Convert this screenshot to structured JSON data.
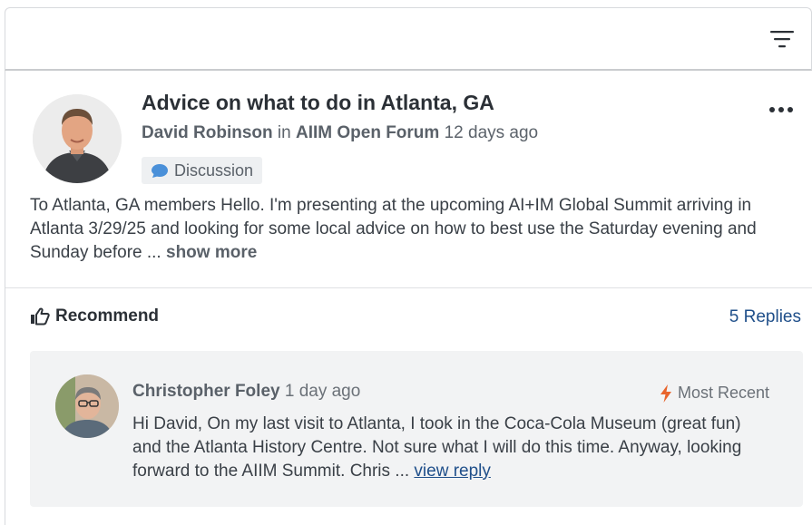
{
  "toolbar": {
    "filter_icon": "filter-icon"
  },
  "post": {
    "title": "Advice on what to do in Atlanta, GA",
    "author": "David Robinson",
    "in_text": " in ",
    "forum": "AIIM Open Forum",
    "time": " 12 days ago",
    "tag": "Discussion",
    "body": "To Atlanta, GA members Hello. I'm presenting at the upcoming AI+IM Global Summit arriving in Atlanta 3/29/25 and looking for some local advice on how to best use the Saturday evening and Sunday before ... ",
    "show_more": "show more",
    "recommend": "Recommend",
    "replies": "5 Replies"
  },
  "reply": {
    "author": "Christopher Foley",
    "time": " 1 day ago",
    "badge": "Most Recent",
    "text": "Hi David, On my last visit to Atlanta, I took in the Coca-Cola Museum (great fun) and the Atlanta History Centre. Not sure what I will do this time. Anyway, looking forward to the AIIM Summit. Chris ... ",
    "view_reply": "view reply"
  },
  "colors": {
    "link": "#1f4f8a",
    "tag_bg": "#eef0f2",
    "reply_bg": "#f2f3f4",
    "bolt": "#e8642c",
    "chat_bubble": "#4a90d9"
  }
}
